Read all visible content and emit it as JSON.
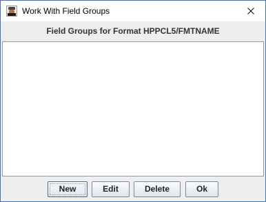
{
  "window": {
    "title": "Work With Field Groups",
    "icon": "app-icon"
  },
  "heading": "Field Groups for Format HPPCL5/FMTNAME",
  "buttons": {
    "new_label": "New",
    "edit_label": "Edit",
    "delete_label": "Delete",
    "ok_label": "Ok"
  },
  "colors": {
    "window_border": "#3c72c4",
    "titlebar_bg": "#ffffff",
    "dialog_bg": "#eeeeee",
    "list_bg": "#ffffff"
  }
}
